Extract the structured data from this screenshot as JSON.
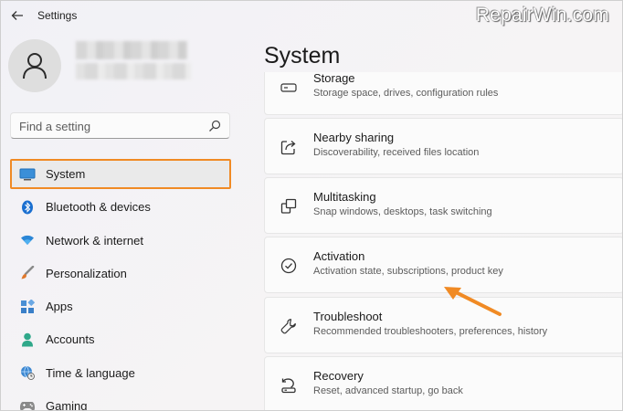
{
  "titlebar": {
    "title": "Settings",
    "watermark": "RepairWin.com"
  },
  "search": {
    "placeholder": "Find a setting"
  },
  "nav": {
    "items": [
      {
        "label": "System",
        "icon": "monitor-icon",
        "selected": true
      },
      {
        "label": "Bluetooth & devices",
        "icon": "bluetooth-icon"
      },
      {
        "label": "Network & internet",
        "icon": "wifi-icon"
      },
      {
        "label": "Personalization",
        "icon": "brush-icon"
      },
      {
        "label": "Apps",
        "icon": "apps-icon"
      },
      {
        "label": "Accounts",
        "icon": "person-icon"
      },
      {
        "label": "Time & language",
        "icon": "globe-clock-icon"
      },
      {
        "label": "Gaming",
        "icon": "gamepad-icon"
      }
    ]
  },
  "main": {
    "title": "System",
    "cards": [
      {
        "title": "Storage",
        "subtitle": "Storage space, drives, configuration rules",
        "icon": "storage-icon"
      },
      {
        "title": "Nearby sharing",
        "subtitle": "Discoverability, received files location",
        "icon": "share-icon"
      },
      {
        "title": "Multitasking",
        "subtitle": "Snap windows, desktops, task switching",
        "icon": "multitasking-icon"
      },
      {
        "title": "Activation",
        "subtitle": "Activation state, subscriptions, product key",
        "icon": "check-circle-icon"
      },
      {
        "title": "Troubleshoot",
        "subtitle": "Recommended troubleshooters, preferences, history",
        "icon": "wrench-icon"
      },
      {
        "title": "Recovery",
        "subtitle": "Reset, advanced startup, go back",
        "icon": "recovery-icon"
      }
    ]
  },
  "colors": {
    "accent": "#0067c0",
    "highlight_border": "#f08a24",
    "arrow": "#f08a24"
  }
}
